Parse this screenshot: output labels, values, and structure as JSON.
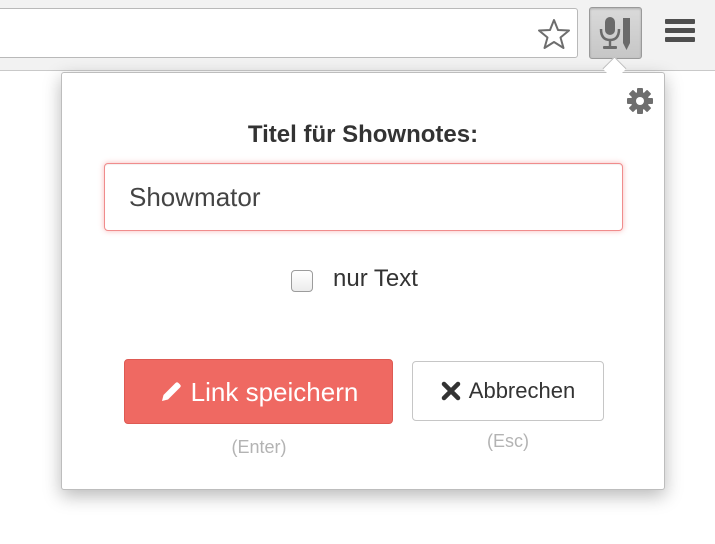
{
  "popup": {
    "title": "Titel für Shownotes:",
    "input_value": "Showmator",
    "checkbox_label": "nur Text",
    "checkbox_checked": false,
    "save_button_label": "Link speichern",
    "save_hint": "(Enter)",
    "cancel_button_label": "Abbrechen",
    "cancel_hint": "(Esc)"
  },
  "icons": {
    "star": "star-outline-icon",
    "extension": "microphone-pencil-icon",
    "menu": "hamburger-menu-icon",
    "settings": "gear-icon",
    "save": "pencil-icon",
    "cancel": "x-mark-icon"
  },
  "colors": {
    "primary": "#ef6962",
    "input_focus_border": "#f08c8c",
    "hint_text": "#b3b3b3"
  }
}
